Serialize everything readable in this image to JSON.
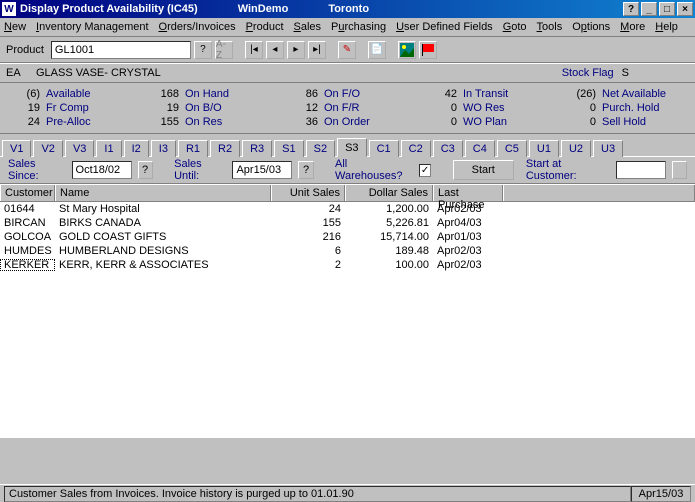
{
  "title": {
    "app": "W",
    "text": "Display Product Availability (IC45)",
    "company": "WinDemo",
    "location": "Toronto"
  },
  "menu": [
    "New",
    "Inventory Management",
    "Orders/Invoices",
    "Product",
    "Sales",
    "Purchasing",
    "User Defined Fields",
    "Goto",
    "Tools",
    "Options",
    "More",
    "Help"
  ],
  "product": {
    "label": "Product",
    "value": "GL1001",
    "az": "A-Z"
  },
  "desc": {
    "ea": "EA",
    "text": "GLASS VASE- CRYSTAL",
    "stockflag_label": "Stock Flag",
    "stockflag_value": "S"
  },
  "stock": [
    [
      {
        "n": "(6)",
        "l": "Available"
      },
      {
        "n": "19",
        "l": "Fr Comp"
      },
      {
        "n": "24",
        "l": "Pre-Alloc"
      }
    ],
    [
      {
        "n": "168",
        "l": "On Hand"
      },
      {
        "n": "19",
        "l": "On B/O"
      },
      {
        "n": "155",
        "l": "On Res"
      }
    ],
    [
      {
        "n": "86",
        "l": "On F/O"
      },
      {
        "n": "12",
        "l": "On F/R"
      },
      {
        "n": "36",
        "l": "On Order"
      }
    ],
    [
      {
        "n": "42",
        "l": "In Transit"
      },
      {
        "n": "0",
        "l": "WO Res"
      },
      {
        "n": "0",
        "l": "WO Plan"
      }
    ],
    [
      {
        "n": "(26)",
        "l": "Net Available"
      },
      {
        "n": "0",
        "l": "Purch. Hold"
      },
      {
        "n": "0",
        "l": "Sell Hold"
      }
    ]
  ],
  "tabs": [
    "V1",
    "V2",
    "V3",
    "I1",
    "I2",
    "I3",
    "R1",
    "R2",
    "R3",
    "S1",
    "S2",
    "S3",
    "C1",
    "C2",
    "C3",
    "C4",
    "C5",
    "U1",
    "U2",
    "U3"
  ],
  "filters": {
    "since_label": "Sales Since:",
    "since": "Oct18/02",
    "until_label": "Sales Until:",
    "until": "Apr15/03",
    "allwh": "All Warehouses?",
    "start": "Start",
    "startcust": "Start at Customer:"
  },
  "cols": {
    "cust": "Customer",
    "name": "Name",
    "units": "Unit Sales",
    "dollar": "Dollar Sales",
    "last": "Last Purchase"
  },
  "rows": [
    {
      "cust": "01644",
      "name": "St Mary Hospital",
      "units": "24",
      "dollar": "1,200.00",
      "last": "Apr02/03"
    },
    {
      "cust": "BIRCAN",
      "name": "BIRKS CANADA",
      "units": "155",
      "dollar": "5,226.81",
      "last": "Apr04/03"
    },
    {
      "cust": "GOLCOA",
      "name": "GOLD COAST GIFTS",
      "units": "216",
      "dollar": "15,714.00",
      "last": "Apr01/03"
    },
    {
      "cust": "HUMDES",
      "name": "HUMBERLAND DESIGNS",
      "units": "6",
      "dollar": "189.48",
      "last": "Apr02/03"
    },
    {
      "cust": "KERKER",
      "name": "KERR, KERR & ASSOCIATES",
      "units": "2",
      "dollar": "100.00",
      "last": "Apr02/03"
    }
  ],
  "status": {
    "left": "Customer Sales from Invoices.   Invoice history is purged up to 01.01.90",
    "date": "Apr15/03"
  }
}
